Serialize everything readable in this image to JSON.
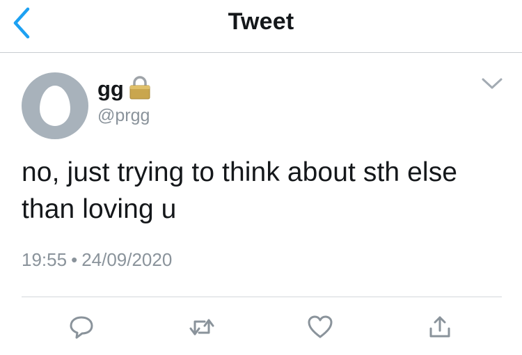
{
  "header": {
    "title": "Tweet"
  },
  "tweet": {
    "display_name": "gg",
    "handle": "@prgg",
    "text": "no, just trying to think about sth else than loving u",
    "time": "19:55",
    "separator": "•",
    "date": "24/09/2020"
  },
  "icons": {
    "back": "chevron-left-icon",
    "lock": "lock-icon",
    "more": "chevron-down-icon",
    "reply": "reply-icon",
    "retweet": "retweet-icon",
    "like": "heart-icon",
    "share": "share-icon"
  },
  "colors": {
    "accent": "#1da1f2",
    "secondary_text": "#8a939b",
    "avatar_bg": "#a8b2bb"
  }
}
